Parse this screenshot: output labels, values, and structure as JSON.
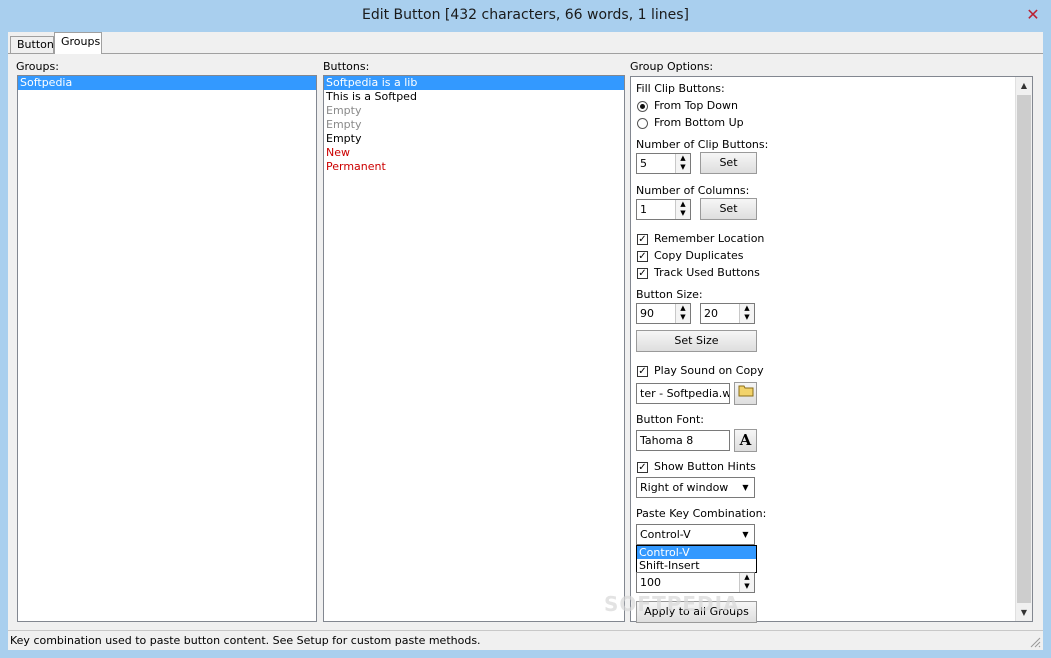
{
  "window": {
    "title": "Edit Button [432 characters, 66 words, 1 lines]",
    "close_glyph": "✕"
  },
  "tabs": [
    {
      "label": "Button",
      "active": false
    },
    {
      "label": "Groups",
      "active": true
    }
  ],
  "groups": {
    "label": "Groups:",
    "items": [
      {
        "text": "Softpedia",
        "selected": true
      }
    ]
  },
  "buttons": {
    "label": "Buttons:",
    "items": [
      {
        "text": "Softpedia is a lib",
        "style": "selected"
      },
      {
        "text": "This is a Softped",
        "style": "normal"
      },
      {
        "text": "Empty",
        "style": "gray"
      },
      {
        "text": "Empty",
        "style": "gray"
      },
      {
        "text": "Empty",
        "style": "normal"
      },
      {
        "text": "New",
        "style": "red"
      },
      {
        "text": "Permanent",
        "style": "red"
      }
    ]
  },
  "options": {
    "label": "Group Options:",
    "fill_label": "Fill Clip Buttons:",
    "from_top": "From Top Down",
    "from_bottom": "From Bottom Up",
    "num_clip_label": "Number of Clip Buttons:",
    "num_clip_value": "5",
    "set_label": "Set",
    "num_cols_label": "Number of Columns:",
    "num_cols_value": "1",
    "remember_location": "Remember Location",
    "copy_duplicates": "Copy Duplicates",
    "track_used": "Track Used Buttons",
    "button_size_label": "Button Size:",
    "size_w": "90",
    "size_h": "20",
    "set_size_label": "Set Size",
    "play_sound": "Play Sound on Copy",
    "sound_file": "ter - Softpedia.wav",
    "button_font_label": "Button Font:",
    "font_value": "Tahoma 8",
    "font_button_glyph": "A",
    "show_hints": "Show Button Hints",
    "hint_position": "Right of window",
    "paste_label": "Paste Key Combination:",
    "paste_value": "Control-V",
    "paste_options": [
      "Control-V",
      "Shift-Insert"
    ],
    "delay_value": "100",
    "apply_all": "Apply to all Groups",
    "check_mark": "✓"
  },
  "status": {
    "text": "Key combination used to paste button content. See Setup for custom paste methods."
  },
  "watermark": "SOFTPEDIA"
}
